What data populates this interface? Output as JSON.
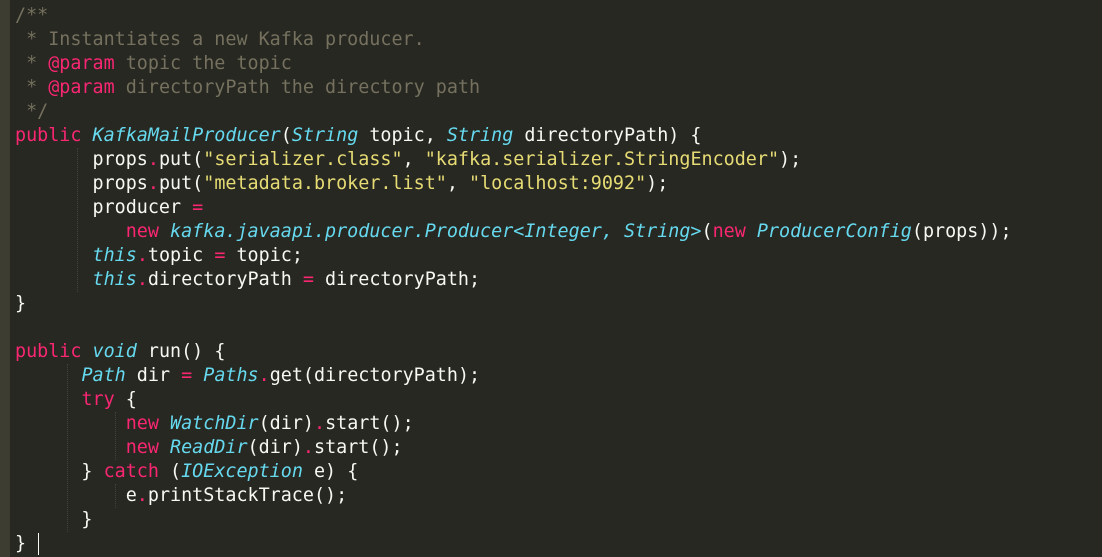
{
  "theme": {
    "background": "#272822",
    "gutter": "#3e3d32",
    "plain": "#f8f8f2",
    "comment": "#75715e",
    "keyword": "#f92672",
    "type": "#66d9ef",
    "string": "#e6db74",
    "guide": "#575851"
  },
  "editor": {
    "lines": [
      [
        {
          "t": "/**",
          "c": "comment"
        }
      ],
      [
        {
          "t": " * Instantiates a new Kafka producer.",
          "c": "comment"
        }
      ],
      [
        {
          "t": " * ",
          "c": "comment"
        },
        {
          "t": "@param",
          "c": "param"
        },
        {
          "t": " topic the topic",
          "c": "comment"
        }
      ],
      [
        {
          "t": " * ",
          "c": "comment"
        },
        {
          "t": "@param",
          "c": "param"
        },
        {
          "t": " directoryPath the directory path",
          "c": "comment"
        }
      ],
      [
        {
          "t": " */",
          "c": "comment"
        }
      ],
      [
        {
          "t": "public",
          "c": "keyword"
        },
        {
          "t": " ",
          "c": "plain"
        },
        {
          "t": "KafkaMailProducer",
          "c": "type"
        },
        {
          "t": "(",
          "c": "plain"
        },
        {
          "t": "String",
          "c": "type"
        },
        {
          "t": " topic, ",
          "c": "plain"
        },
        {
          "t": "String",
          "c": "type"
        },
        {
          "t": " directoryPath) {",
          "c": "plain"
        }
      ],
      [
        {
          "t": "       props",
          "c": "plain"
        },
        {
          "t": ".",
          "c": "keyword"
        },
        {
          "t": "put(",
          "c": "plain"
        },
        {
          "t": "\"serializer.class\"",
          "c": "string"
        },
        {
          "t": ", ",
          "c": "plain"
        },
        {
          "t": "\"kafka.serializer.StringEncoder\"",
          "c": "string"
        },
        {
          "t": ");",
          "c": "plain"
        }
      ],
      [
        {
          "t": "       props",
          "c": "plain"
        },
        {
          "t": ".",
          "c": "keyword"
        },
        {
          "t": "put(",
          "c": "plain"
        },
        {
          "t": "\"metadata.broker.list\"",
          "c": "string"
        },
        {
          "t": ", ",
          "c": "plain"
        },
        {
          "t": "\"localhost:9092\"",
          "c": "string"
        },
        {
          "t": ");",
          "c": "plain"
        }
      ],
      [
        {
          "t": "       producer ",
          "c": "plain"
        },
        {
          "t": "=",
          "c": "keyword"
        }
      ],
      [
        {
          "t": "          ",
          "c": "plain"
        },
        {
          "t": "new",
          "c": "keyword"
        },
        {
          "t": " ",
          "c": "plain"
        },
        {
          "t": "kafka.javaapi.producer.Producer<Integer, String>",
          "c": "type"
        },
        {
          "t": "(",
          "c": "plain"
        },
        {
          "t": "new",
          "c": "keyword"
        },
        {
          "t": " ",
          "c": "plain"
        },
        {
          "t": "ProducerConfig",
          "c": "type"
        },
        {
          "t": "(props));",
          "c": "plain"
        }
      ],
      [
        {
          "t": "       ",
          "c": "plain"
        },
        {
          "t": "this",
          "c": "type"
        },
        {
          "t": ".",
          "c": "keyword"
        },
        {
          "t": "topic ",
          "c": "plain"
        },
        {
          "t": "=",
          "c": "keyword"
        },
        {
          "t": " topic;",
          "c": "plain"
        }
      ],
      [
        {
          "t": "       ",
          "c": "plain"
        },
        {
          "t": "this",
          "c": "type"
        },
        {
          "t": ".",
          "c": "keyword"
        },
        {
          "t": "directoryPath ",
          "c": "plain"
        },
        {
          "t": "=",
          "c": "keyword"
        },
        {
          "t": " directoryPath;",
          "c": "plain"
        }
      ],
      [
        {
          "t": "}",
          "c": "plain"
        }
      ],
      [
        {
          "t": "",
          "c": "plain"
        }
      ],
      [
        {
          "t": "public",
          "c": "keyword"
        },
        {
          "t": " ",
          "c": "plain"
        },
        {
          "t": "void",
          "c": "type"
        },
        {
          "t": " run() {",
          "c": "plain"
        }
      ],
      [
        {
          "t": "      ",
          "c": "plain"
        },
        {
          "t": "Path",
          "c": "type"
        },
        {
          "t": " dir ",
          "c": "plain"
        },
        {
          "t": "=",
          "c": "keyword"
        },
        {
          "t": " ",
          "c": "plain"
        },
        {
          "t": "Paths",
          "c": "type"
        },
        {
          "t": ".",
          "c": "keyword"
        },
        {
          "t": "get(directoryPath);",
          "c": "plain"
        }
      ],
      [
        {
          "t": "      ",
          "c": "plain"
        },
        {
          "t": "try",
          "c": "keyword"
        },
        {
          "t": " {",
          "c": "plain"
        }
      ],
      [
        {
          "t": "          ",
          "c": "plain"
        },
        {
          "t": "new",
          "c": "keyword"
        },
        {
          "t": " ",
          "c": "plain"
        },
        {
          "t": "WatchDir",
          "c": "type"
        },
        {
          "t": "(dir)",
          "c": "plain"
        },
        {
          "t": ".",
          "c": "keyword"
        },
        {
          "t": "start();",
          "c": "plain"
        }
      ],
      [
        {
          "t": "          ",
          "c": "plain"
        },
        {
          "t": "new",
          "c": "keyword"
        },
        {
          "t": " ",
          "c": "plain"
        },
        {
          "t": "ReadDir",
          "c": "type"
        },
        {
          "t": "(dir)",
          "c": "plain"
        },
        {
          "t": ".",
          "c": "keyword"
        },
        {
          "t": "start();",
          "c": "plain"
        }
      ],
      [
        {
          "t": "      } ",
          "c": "plain"
        },
        {
          "t": "catch",
          "c": "keyword"
        },
        {
          "t": " (",
          "c": "plain"
        },
        {
          "t": "IOException",
          "c": "type"
        },
        {
          "t": " e) {",
          "c": "plain"
        }
      ],
      [
        {
          "t": "          e",
          "c": "plain"
        },
        {
          "t": ".",
          "c": "keyword"
        },
        {
          "t": "printStackTrace();",
          "c": "plain"
        }
      ],
      [
        {
          "t": "      }",
          "c": "plain"
        }
      ],
      [
        {
          "t": "}",
          "c": "plain"
        }
      ]
    ]
  }
}
